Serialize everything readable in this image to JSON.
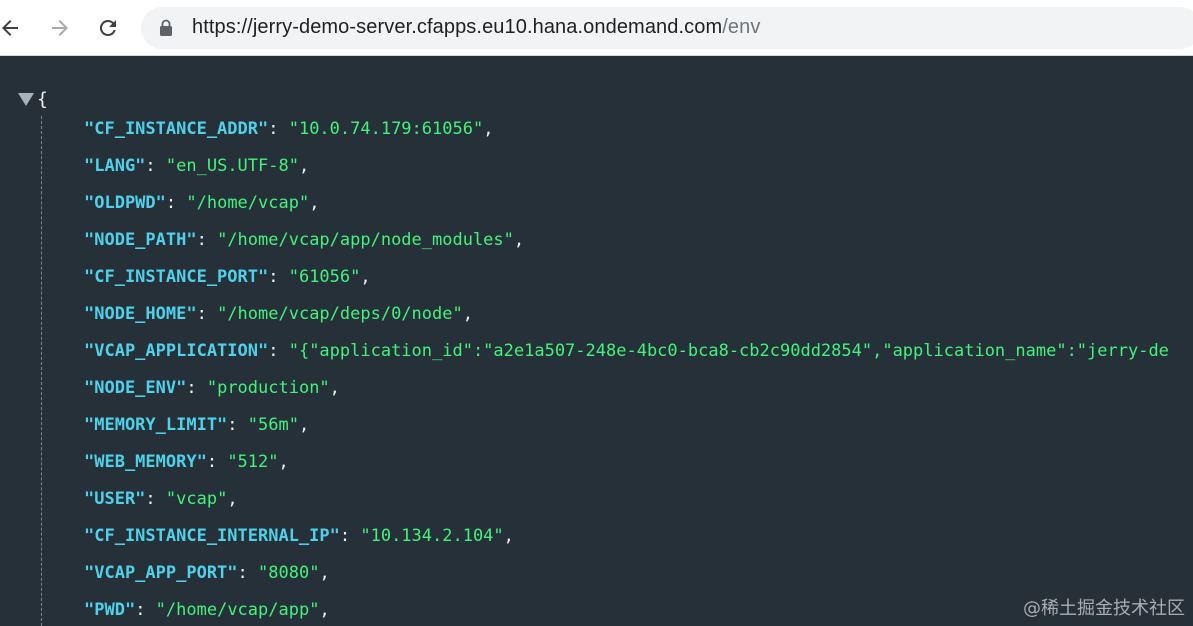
{
  "browser": {
    "url_host": "https://jerry-demo-server.cfapps.eu10.hana.ondemand.com",
    "url_path": "/env"
  },
  "json_view": {
    "open_brace": "{",
    "entries": [
      {
        "key": "\"CF_INSTANCE_ADDR\"",
        "value": "\"10.0.74.179:61056\""
      },
      {
        "key": "\"LANG\"",
        "value": "\"en_US.UTF-8\""
      },
      {
        "key": "\"OLDPWD\"",
        "value": "\"/home/vcap\""
      },
      {
        "key": "\"NODE_PATH\"",
        "value": "\"/home/vcap/app/node_modules\""
      },
      {
        "key": "\"CF_INSTANCE_PORT\"",
        "value": "\"61056\""
      },
      {
        "key": "\"NODE_HOME\"",
        "value": "\"/home/vcap/deps/0/node\""
      },
      {
        "key": "\"VCAP_APPLICATION\"",
        "value": "\"{\"application_id\":\"a2e1a507-248e-4bc0-bca8-cb2c90dd2854\",\"application_name\":\"jerry-de"
      },
      {
        "key": "\"NODE_ENV\"",
        "value": "\"production\""
      },
      {
        "key": "\"MEMORY_LIMIT\"",
        "value": "\"56m\""
      },
      {
        "key": "\"WEB_MEMORY\"",
        "value": "\"512\""
      },
      {
        "key": "\"USER\"",
        "value": "\"vcap\""
      },
      {
        "key": "\"CF_INSTANCE_INTERNAL_IP\"",
        "value": "\"10.134.2.104\""
      },
      {
        "key": "\"VCAP_APP_PORT\"",
        "value": "\"8080\""
      },
      {
        "key": "\"PWD\"",
        "value": "\"/home/vcap/app\""
      }
    ],
    "colon": ": ",
    "comma": ","
  },
  "watermark": "@稀土掘金技术社区",
  "colors": {
    "background": "#263038",
    "key": "#4fd1ea",
    "value": "#43f27d"
  },
  "icons": {
    "back": "arrow-left-icon",
    "forward": "arrow-right-icon",
    "reload": "reload-icon",
    "lock": "lock-icon",
    "toggle": "triangle-down-icon"
  }
}
